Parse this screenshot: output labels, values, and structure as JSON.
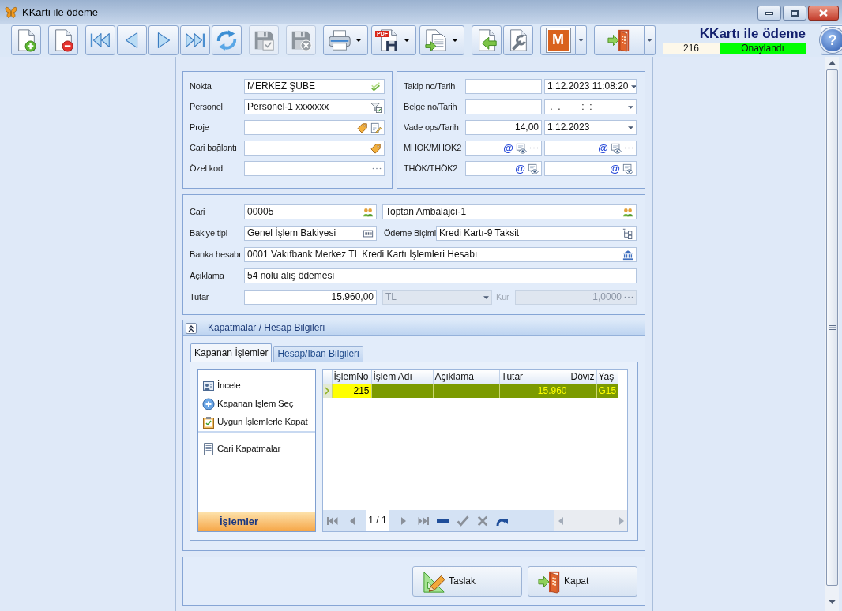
{
  "window": {
    "title": "KKartı ile ödeme"
  },
  "toolbar": [
    [
      {
        "kind": "button",
        "disabled": false
      }
    ],
    [
      {
        "kind": "button",
        "disabled": false
      }
    ],
    [
      {
        "kind": "button",
        "disabled": false
      },
      {
        "kind": "button",
        "disabled": false
      },
      {
        "kind": "button",
        "disabled": false
      },
      {
        "kind": "button",
        "disabled": false
      },
      {
        "kind": "button",
        "disabled": false
      }
    ],
    [
      {
        "kind": "button",
        "disabled": true
      }
    ],
    [
      {
        "kind": "button",
        "disabled": true
      }
    ],
    [
      {
        "kind": "dropdown",
        "disabled": false
      },
      {
        "kind": "dropdown",
        "disabled": false,
        "tag": "PDF"
      },
      {
        "kind": "dropdown",
        "disabled": false
      }
    ],
    [
      {
        "kind": "button",
        "disabled": false
      },
      {
        "kind": "button",
        "disabled": false
      }
    ],
    [
      {
        "kind": "split",
        "disabled": false,
        "letter": "M"
      }
    ],
    [
      {
        "kind": "split",
        "disabled": false
      }
    ]
  ],
  "record": {
    "title": "KKartı ile ödeme",
    "number": "216",
    "status": "Onaylandı"
  },
  "help": {
    "label": "?"
  },
  "general": [
    {
      "label": "Nokta",
      "value": "MERKEZ ŞUBE"
    },
    {
      "label": "Personel",
      "value": "Personel-1 xxxxxxx"
    },
    {
      "label": "Proje"
    },
    {
      "label": "Cari bağlantı"
    },
    {
      "label": "Özel kod"
    }
  ],
  "tracking": [
    {
      "label": "Takip no/Tarih",
      "fields": [
        {
          "kind": "text"
        },
        {
          "kind": "date",
          "value": "1.12.2023 11:08:20"
        }
      ]
    },
    {
      "label": "Belge no/Tarih",
      "fields": [
        {
          "kind": "text"
        },
        {
          "kind": "date",
          "value": " .  .        :  :"
        }
      ]
    },
    {
      "label": "Vade ops/Tarih",
      "fields": [
        {
          "kind": "number",
          "value": "14,00"
        },
        {
          "kind": "date",
          "value": "1.12.2023"
        }
      ]
    },
    {
      "label": "MHÖK/MHÖK2",
      "fields": [
        {
          "kind": "contact",
          "symbol": "@",
          "more": true
        },
        {
          "kind": "contact",
          "symbol": "@",
          "more": true
        }
      ]
    },
    {
      "label": "THÖK/THÖK2",
      "fields": [
        {
          "kind": "contact",
          "symbol": "@",
          "more": false
        },
        {
          "kind": "contact",
          "symbol": "@",
          "more": false
        }
      ]
    }
  ],
  "account": {
    "cari": {
      "label": "Cari",
      "code": "00005",
      "name": "Toptan Ambalajcı-1"
    },
    "balance_type": {
      "label": "Bakiye tipi",
      "value": "Genel İşlem Bakiyesi"
    },
    "payment_method": {
      "label": "Ödeme Biçimi",
      "value": "Kredi Kartı-9 Taksit"
    },
    "bank_account": {
      "label": "Banka hesabı",
      "value": "0001 Vakıfbank Merkez TL Kredi Kartı İşlemleri Hesabı"
    },
    "description": {
      "label": "Açıklama",
      "value": "54 nolu alış ödemesi"
    },
    "amount": {
      "label": "Tutar",
      "value": "15.960,00"
    },
    "currency": {
      "value": "TL",
      "disabled": true
    },
    "rate": {
      "label": "Kur",
      "value": "1,0000",
      "disabled": true
    }
  },
  "closings": {
    "title": "Kapatmalar / Hesap Bilgileri",
    "expanded": true,
    "tabs": [
      {
        "label": "Kapanan İşlemler",
        "selected": true
      },
      {
        "label": "Hesap/Iban Bilgileri",
        "selected": false
      }
    ],
    "actions": [
      [
        {
          "label": "İncele"
        },
        {
          "label": "Kapanan İşlem Seç"
        },
        {
          "label": "Uygun İşlemlerle Kapat"
        }
      ],
      [
        {
          "label": "Cari Kapatmalar"
        }
      ]
    ],
    "actions_footer": "İşlemler",
    "grid": {
      "columns": [
        "İşlemNo",
        "İşlem Adı",
        "Açıklama",
        "Tutar",
        "Döviz",
        "Yaş"
      ],
      "rows": [
        {
          "selected": true,
          "cells": [
            "215",
            null,
            null,
            "15.960",
            null,
            "G15"
          ]
        }
      ],
      "pager": "1 / 1"
    }
  },
  "buttons": [
    {
      "label": "Taslak"
    },
    {
      "label": "Kapat"
    }
  ]
}
